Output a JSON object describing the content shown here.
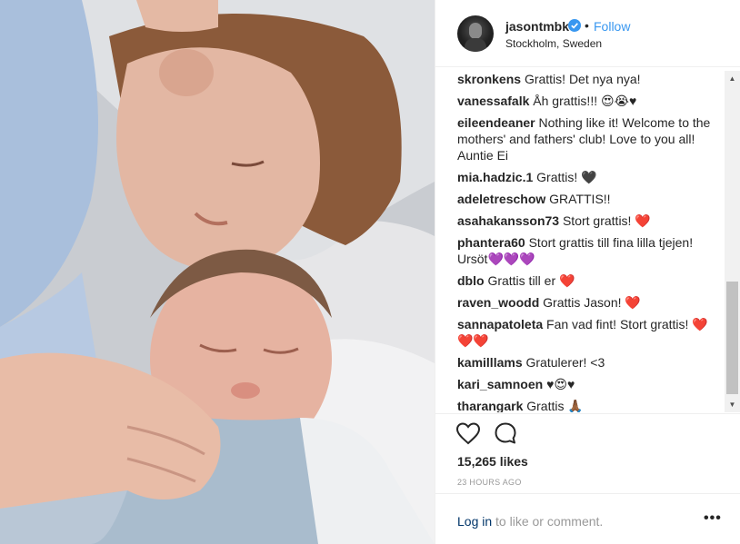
{
  "post": {
    "username": "jasontmbk",
    "follow_label": "Follow",
    "separator": "•",
    "location": "Stockholm, Sweden",
    "verified_icon": "verified-badge-icon",
    "accent_color": "#3897f0"
  },
  "comments": [
    {
      "user": "skronkens",
      "text": "Grattis! Det nya nya!"
    },
    {
      "user": "vanessafalk",
      "text": "Åh grattis!!! 😍😭♥"
    },
    {
      "user": "eileendeaner",
      "text": "Nothing like it! Welcome to the mothers' and fathers' club! Love to you all! Auntie Ei"
    },
    {
      "user": "mia.hadzic.1",
      "text": "Grattis! 🖤"
    },
    {
      "user": "adeletreschow",
      "text": "GRATTIS!!"
    },
    {
      "user": "asahakansson73",
      "text": "Stort grattis! ❤️"
    },
    {
      "user": "phantera60",
      "text": "Stort grattis till fina lilla tjejen! Ursöt💜💜💜"
    },
    {
      "user": "dblo",
      "text": "Grattis till er ❤️"
    },
    {
      "user": "raven_woodd",
      "text": "Grattis Jason! ❤️"
    },
    {
      "user": "sannapatoleta",
      "text": "Fan vad fint! Stort grattis! ❤️❤️❤️"
    },
    {
      "user": "kamilllams",
      "text": "Gratulerer! <3"
    },
    {
      "user": "kari_samnoen",
      "text": "♥😍♥"
    },
    {
      "user": "tharangark",
      "text": "Grattis 🙏🏾"
    }
  ],
  "actions": {
    "like_icon": "heart-icon",
    "comment_icon": "comment-icon",
    "likes": "15,265 likes",
    "time": "23 HOURS AGO"
  },
  "footer": {
    "login_link": "Log in",
    "login_suffix": " to like or comment.",
    "more": "•••"
  },
  "scrollbar": {
    "up_arrow": "▲",
    "down_arrow": "▼"
  }
}
